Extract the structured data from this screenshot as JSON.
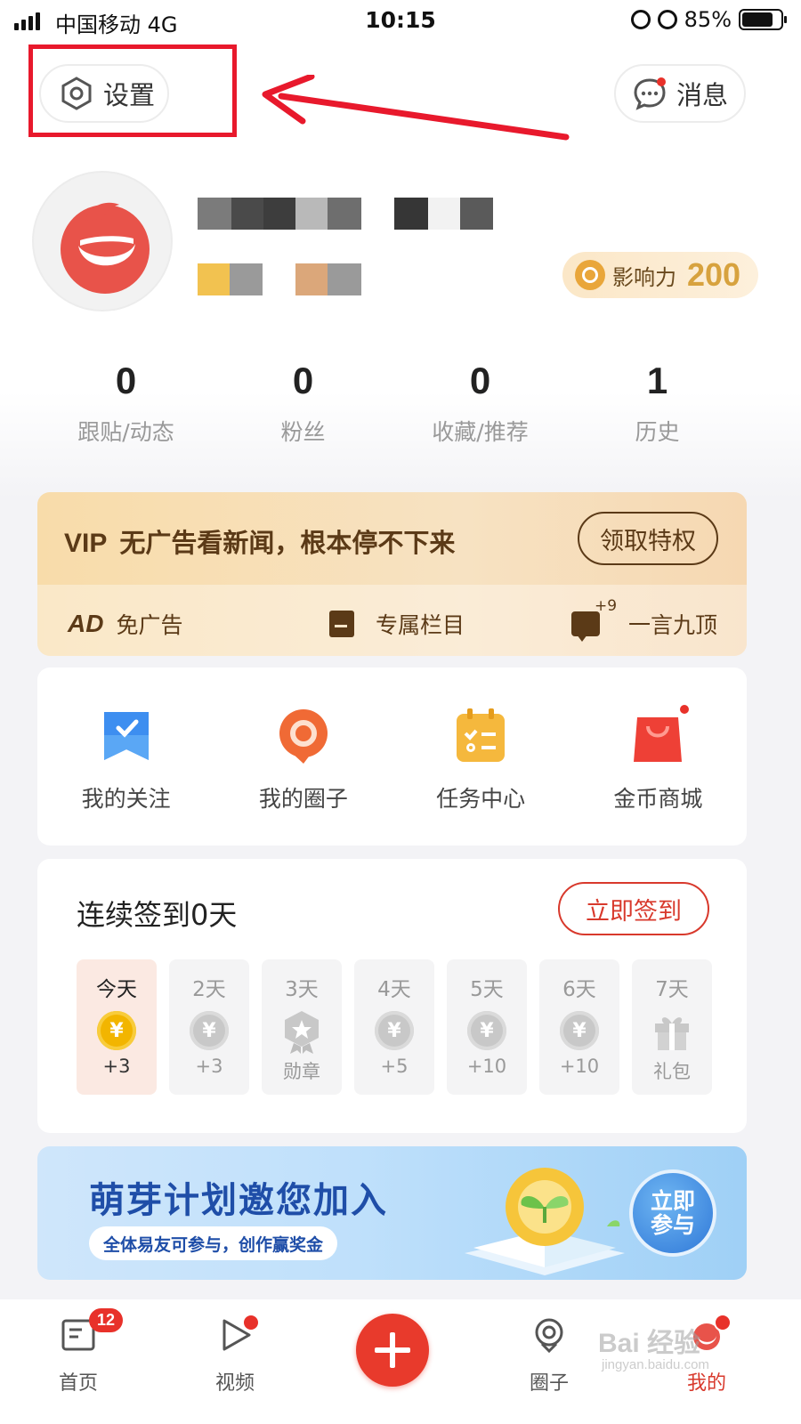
{
  "status_bar": {
    "carrier": "中国移动  4G",
    "time": "10:15",
    "battery_percent": "85%"
  },
  "header": {
    "settings_label": "设置",
    "messages_label": "消息"
  },
  "profile": {
    "influence_label": "影响力",
    "influence_value": "200"
  },
  "stats": [
    {
      "value": "0",
      "label": "跟贴/动态"
    },
    {
      "value": "0",
      "label": "粉丝"
    },
    {
      "value": "0",
      "label": "收藏/推荐"
    },
    {
      "value": "1",
      "label": "历史"
    }
  ],
  "vip": {
    "tag": "VIP",
    "slogan": "无广告看新闻，根本停不下来",
    "button": "领取特权",
    "perks": [
      {
        "icon": "ad-icon",
        "icon_text": "AD",
        "label": "免广告"
      },
      {
        "icon": "column-icon",
        "label": "专属栏目"
      },
      {
        "icon": "comment-boost-icon",
        "sup": "+9",
        "label": "一言九顶"
      }
    ]
  },
  "shortcuts": [
    {
      "icon": "bookmark-icon",
      "label": "我的关注",
      "color": "#3d8ef0"
    },
    {
      "icon": "circle-chat-icon",
      "label": "我的圈子",
      "color": "#f06a35"
    },
    {
      "icon": "task-icon",
      "label": "任务中心",
      "color": "#f5b83d"
    },
    {
      "icon": "shopping-bag-icon",
      "label": "金币商城",
      "color": "#ee4036"
    }
  ],
  "checkin": {
    "title": "连续签到0天",
    "button": "立即签到",
    "days": [
      {
        "day": "今天",
        "reward": "+3",
        "icon": "gold-coin-icon",
        "today": true
      },
      {
        "day": "2天",
        "reward": "+3",
        "icon": "coin-icon"
      },
      {
        "day": "3天",
        "reward": "勋章",
        "icon": "medal-icon"
      },
      {
        "day": "4天",
        "reward": "+5",
        "icon": "coin-icon"
      },
      {
        "day": "5天",
        "reward": "+10",
        "icon": "coin-icon"
      },
      {
        "day": "6天",
        "reward": "+10",
        "icon": "coin-icon"
      },
      {
        "day": "7天",
        "reward": "礼包",
        "icon": "gift-icon"
      }
    ],
    "coin_symbol": "¥"
  },
  "banner": {
    "title": "萌芽计划邀您加入",
    "subtitle": "全体易友可参与，创作赢奖金",
    "cta": "立即参与"
  },
  "tabbar": {
    "tabs": [
      {
        "label": "首页",
        "badge": "12"
      },
      {
        "label": "视频"
      },
      {
        "label": "圈子"
      },
      {
        "label": "我的",
        "active": true
      }
    ]
  },
  "watermark": {
    "text": "Bai 经验",
    "url": "jingyan.baidu.com"
  }
}
